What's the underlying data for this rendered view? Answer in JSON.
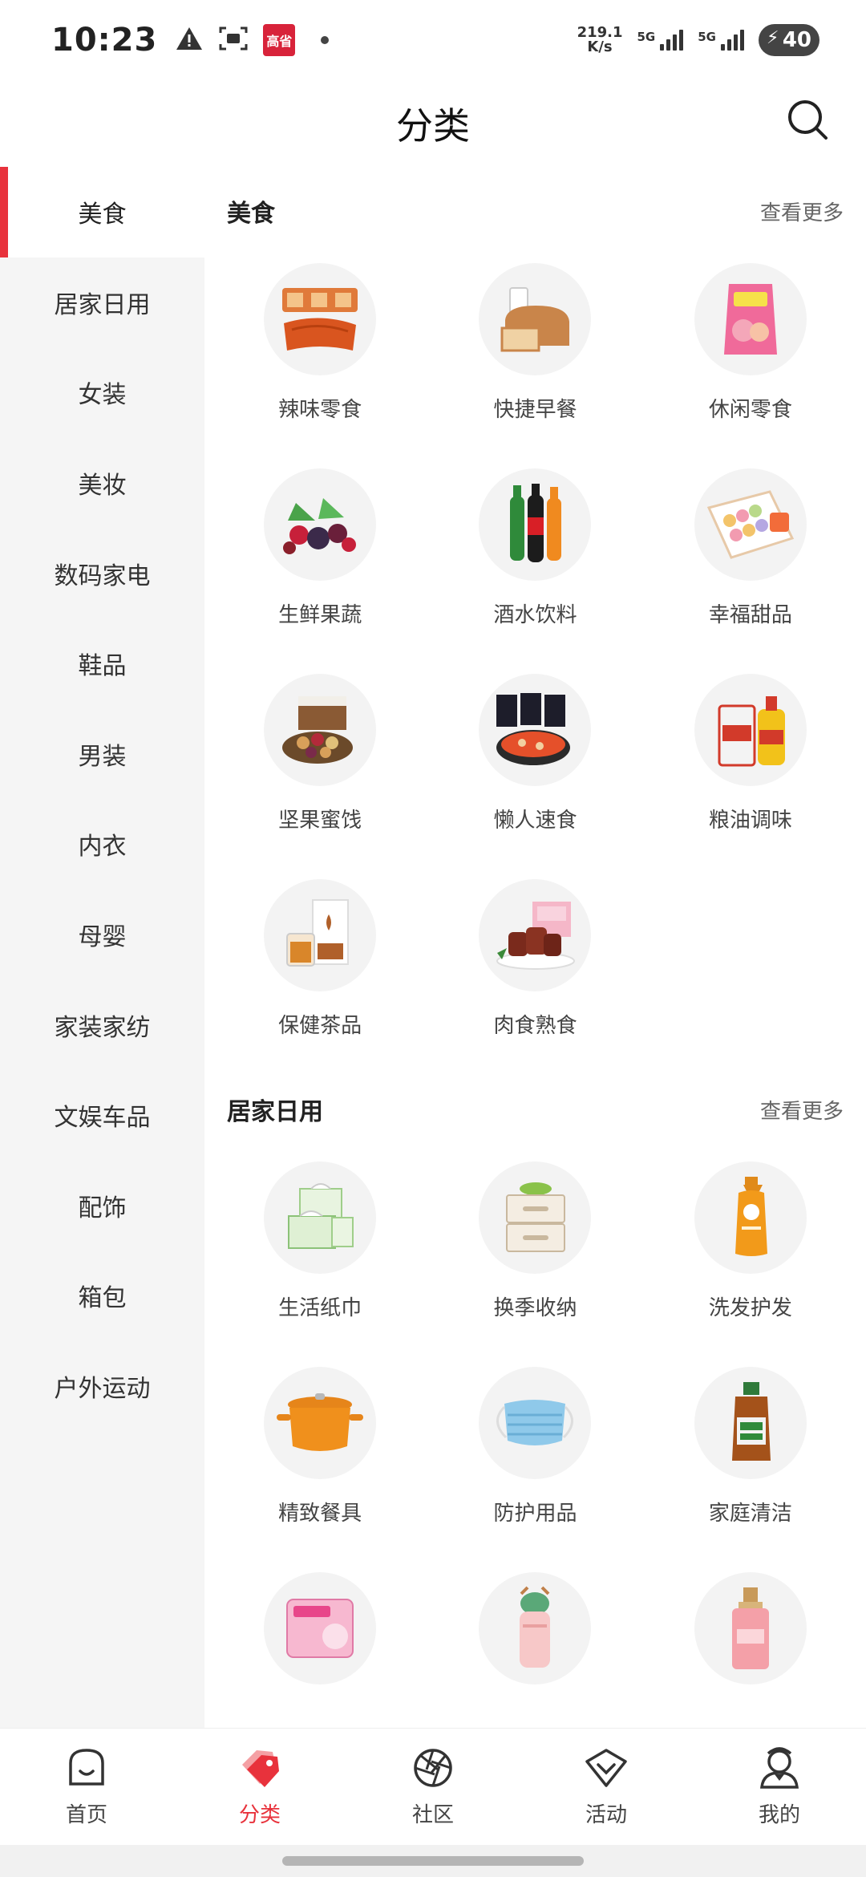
{
  "status_bar": {
    "time": "10:23",
    "app_badge": "高省",
    "net_speed_value": "219.1",
    "net_speed_unit": "K/s",
    "sim1_label": "5G",
    "sim2_label": "5G",
    "battery": "40"
  },
  "header": {
    "title": "分类"
  },
  "sidebar": {
    "items": [
      {
        "label": "美食"
      },
      {
        "label": "居家日用"
      },
      {
        "label": "女装"
      },
      {
        "label": "美妆"
      },
      {
        "label": "数码家电"
      },
      {
        "label": "鞋品"
      },
      {
        "label": "男装"
      },
      {
        "label": "内衣"
      },
      {
        "label": "母婴"
      },
      {
        "label": "家装家纺"
      },
      {
        "label": "文娱车品"
      },
      {
        "label": "配饰"
      },
      {
        "label": "箱包"
      },
      {
        "label": "户外运动"
      }
    ]
  },
  "sections": [
    {
      "title": "美食",
      "more": "查看更多",
      "items": [
        {
          "label": "辣味零食",
          "icon": "spicy-snack-icon"
        },
        {
          "label": "快捷早餐",
          "icon": "bread-icon"
        },
        {
          "label": "休闲零食",
          "icon": "chips-icon"
        },
        {
          "label": "生鲜果蔬",
          "icon": "berries-icon"
        },
        {
          "label": "酒水饮料",
          "icon": "drinks-icon"
        },
        {
          "label": "幸福甜品",
          "icon": "macaron-icon"
        },
        {
          "label": "坚果蜜饯",
          "icon": "nuts-icon"
        },
        {
          "label": "懒人速食",
          "icon": "instant-food-icon"
        },
        {
          "label": "粮油调味",
          "icon": "rice-oil-icon"
        },
        {
          "label": "保健茶品",
          "icon": "tea-icon"
        },
        {
          "label": "肉食熟食",
          "icon": "meat-icon"
        }
      ]
    },
    {
      "title": "居家日用",
      "more": "查看更多",
      "items": [
        {
          "label": "生活纸巾",
          "icon": "tissue-icon"
        },
        {
          "label": "换季收纳",
          "icon": "storage-icon"
        },
        {
          "label": "洗发护发",
          "icon": "shampoo-icon"
        },
        {
          "label": "精致餐具",
          "icon": "pot-icon"
        },
        {
          "label": "防护用品",
          "icon": "mask-icon"
        },
        {
          "label": "家庭清洁",
          "icon": "disinfectant-icon"
        },
        {
          "label": "",
          "icon": "sanitary-pad-icon"
        },
        {
          "label": "",
          "icon": "water-bottle-icon"
        },
        {
          "label": "",
          "icon": "perfume-icon"
        }
      ]
    }
  ],
  "bottom_nav": {
    "items": [
      {
        "label": "首页",
        "icon": "home-icon"
      },
      {
        "label": "分类",
        "icon": "category-tag-icon"
      },
      {
        "label": "社区",
        "icon": "community-icon"
      },
      {
        "label": "活动",
        "icon": "activity-icon"
      },
      {
        "label": "我的",
        "icon": "profile-icon"
      }
    ]
  },
  "colors": {
    "accent": "#e8323c",
    "sidebar_bg": "#f5f5f5",
    "thumb_bg": "#f3f3f3"
  }
}
